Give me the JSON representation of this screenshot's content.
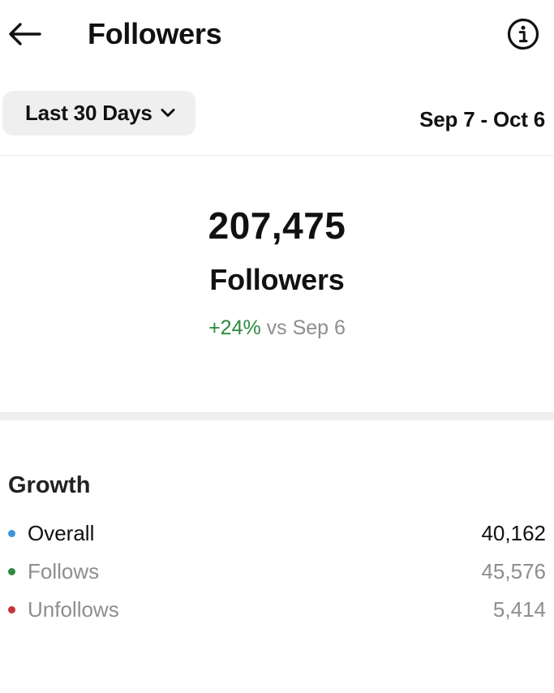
{
  "header": {
    "title": "Followers",
    "back_icon": "arrow-left-icon",
    "info_icon": "info-circle-icon"
  },
  "filter": {
    "range_label": "Last 30 Days",
    "range_icon": "chevron-down-icon",
    "date_range": "Sep 7 - Oct 6"
  },
  "summary": {
    "total": "207,475",
    "label": "Followers",
    "delta": "+24%",
    "comparison": "vs Sep 6"
  },
  "growth": {
    "title": "Growth",
    "rows": [
      {
        "label": "Overall",
        "value": "40,162",
        "dot_color": "#3d96de"
      },
      {
        "label": "Follows",
        "value": "45,576",
        "dot_color": "#2d8a3e"
      },
      {
        "label": "Unfollows",
        "value": "5,414",
        "dot_color": "#c8323b"
      }
    ]
  },
  "colors": {
    "positive": "#2d8a3e",
    "muted_text": "#8e8e8e",
    "pill_background": "#efefef"
  }
}
